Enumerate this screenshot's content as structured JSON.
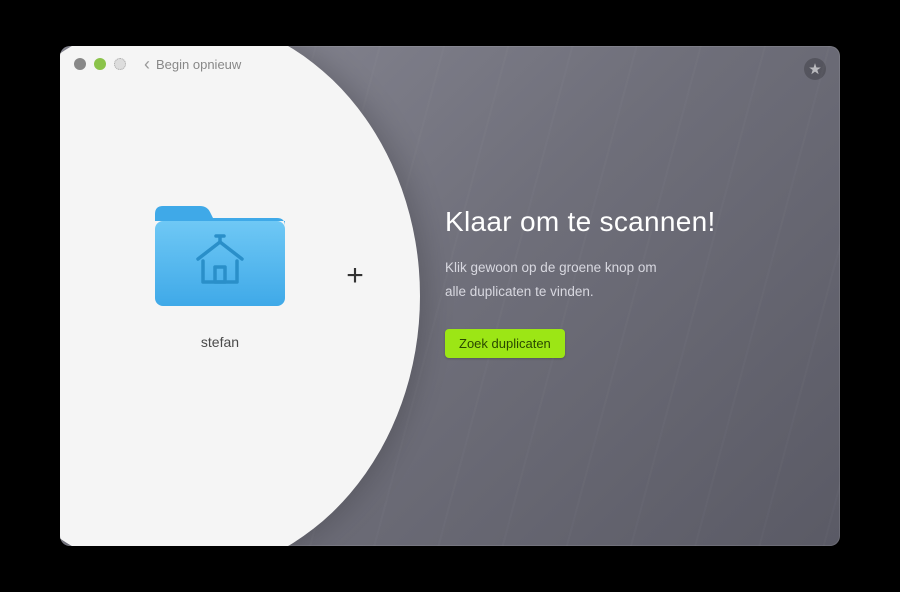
{
  "nav": {
    "back_label": "Begin opnieuw"
  },
  "folder": {
    "name": "stefan"
  },
  "main": {
    "heading": "Klaar om te scannen!",
    "description_line1": "Klik gewoon op de groene knop om",
    "description_line2": "alle duplicaten te vinden.",
    "cta_label": "Zoek duplicaten"
  }
}
